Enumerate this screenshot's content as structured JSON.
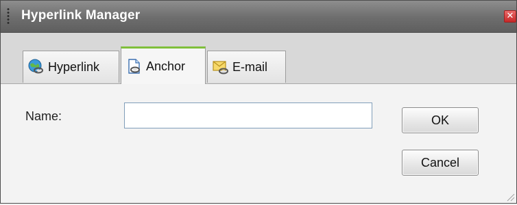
{
  "dialog": {
    "title": "Hyperlink Manager",
    "close_icon": "close-icon",
    "close_glyph": "✕"
  },
  "tabs": [
    {
      "label": "Hyperlink",
      "icon": "globe-link-icon",
      "active": false
    },
    {
      "label": "Anchor",
      "icon": "anchor-page-icon",
      "active": true
    },
    {
      "label": "E-mail",
      "icon": "envelope-link-icon",
      "active": false
    }
  ],
  "form": {
    "name_label": "Name:",
    "name_value": "",
    "name_placeholder": ""
  },
  "buttons": {
    "ok_label": "OK",
    "cancel_label": "Cancel"
  },
  "colors": {
    "titlebar": "#6d6d6d",
    "active_tab_accent": "#7fbf3a",
    "close_button": "#c62828"
  }
}
